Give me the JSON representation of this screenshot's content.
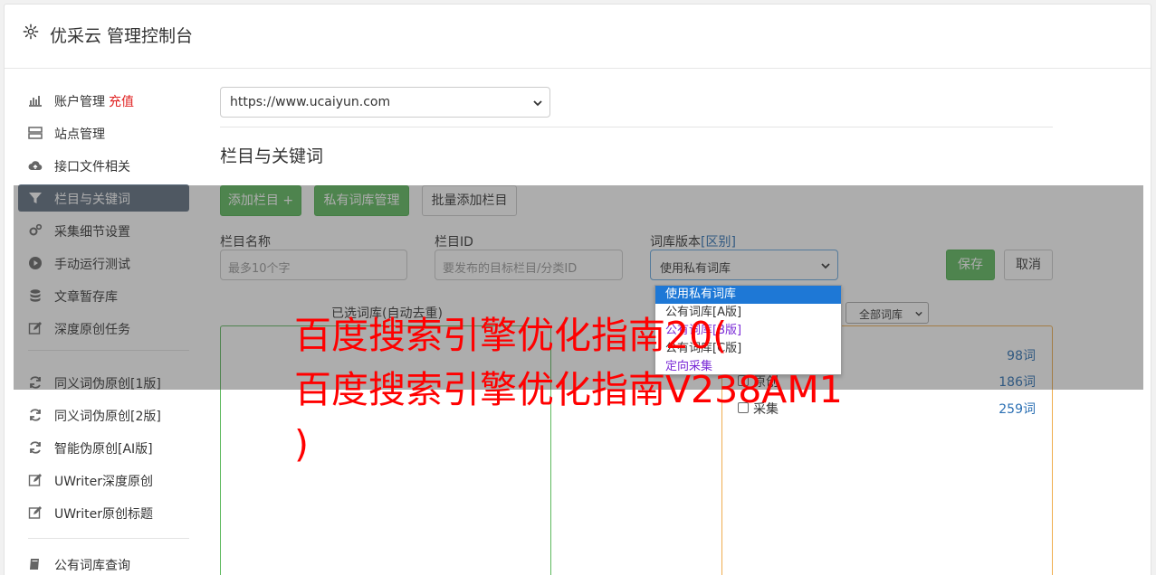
{
  "header": {
    "title": "优采云 管理控制台",
    "icon": "gear-icon"
  },
  "sidebar": {
    "items": [
      {
        "label": "账户管理",
        "badge": "充值",
        "icon": "bar-chart-icon"
      },
      {
        "label": "站点管理",
        "icon": "server-icon"
      },
      {
        "label": "接口文件相关",
        "icon": "cloud-upload-icon"
      },
      {
        "label": "栏目与关键词",
        "icon": "filter-icon",
        "active": true
      },
      {
        "label": "采集细节设置",
        "icon": "cogs-icon"
      },
      {
        "label": "手动运行测试",
        "icon": "play-circle-icon"
      },
      {
        "label": "文章暂存库",
        "icon": "database-icon"
      },
      {
        "label": "深度原创任务",
        "icon": "edit-icon"
      },
      {
        "label": "同义词伪原创[1版]",
        "icon": "refresh-icon"
      },
      {
        "label": "同义词伪原创[2版]",
        "icon": "refresh-icon"
      },
      {
        "label": "智能伪原创[AI版]",
        "icon": "refresh-icon"
      },
      {
        "label": "UWriter深度原创",
        "icon": "edit-icon"
      },
      {
        "label": "UWriter原创标题",
        "icon": "edit-icon"
      },
      {
        "label": "公有词库查询",
        "icon": "book-icon"
      }
    ]
  },
  "site_select": {
    "value": "https://www.ucaiyun.com"
  },
  "section": {
    "title": "栏目与关键词"
  },
  "toolbar": {
    "add_column": "添加栏目 +",
    "private_lib": "私有词库管理",
    "batch_add": "批量添加栏目"
  },
  "form": {
    "name_label": "栏目名称",
    "name_placeholder": "最多10个字",
    "id_label": "栏目ID",
    "id_placeholder": "要发布的目标栏目/分类ID",
    "version_label": "词库版本",
    "version_link": "[区别]",
    "version_value": "使用私有词库",
    "save": "保存",
    "cancel": "取消"
  },
  "dropdown": {
    "options": [
      "使用私有词库",
      "公有词库[A版]",
      "公有词库[B版]",
      "公有词库[C版]",
      "定向采集"
    ]
  },
  "lists": {
    "selected_label": "已选词库(自动去重)",
    "filter_value": "全部词库",
    "rows": [
      {
        "name": "",
        "count": "98词"
      },
      {
        "name": "原创",
        "count": "186词"
      },
      {
        "name": "采集",
        "count": "259词"
      }
    ]
  },
  "watermark": {
    "line1": "百度搜索引擎优化指南20(",
    "line2": "百度搜索引擎优化指南V238AM1",
    "line3": ")"
  },
  "colors": {
    "accent_green": "#5cb85c",
    "active_nav": "#5d6d7e",
    "watermark": "#ff0000",
    "link_blue": "#2a6fb3"
  }
}
